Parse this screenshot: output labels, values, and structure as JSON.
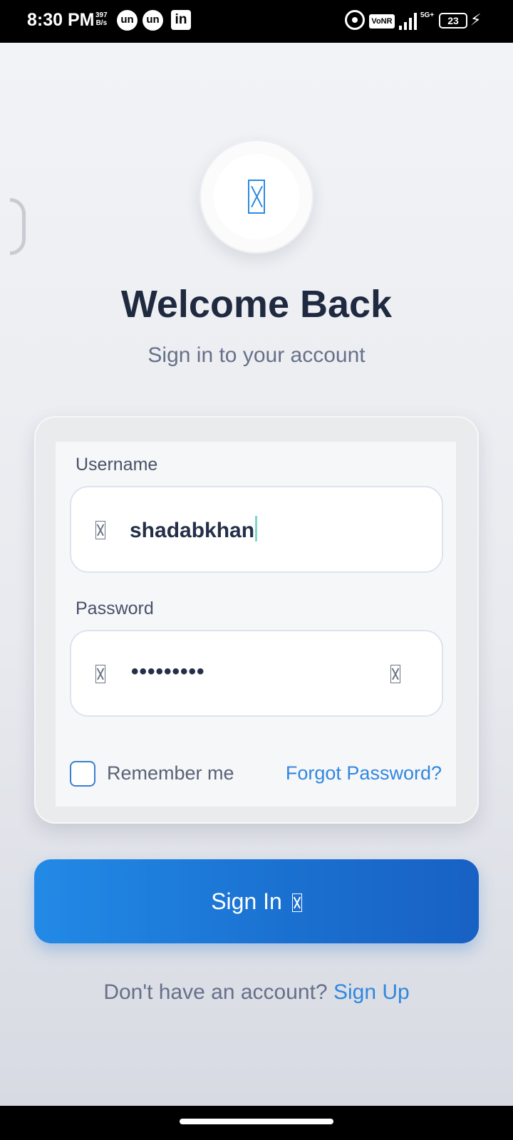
{
  "status_bar": {
    "time": "8:30 PM",
    "net_speed_value": "397",
    "net_speed_unit": "B/s",
    "app_icon_1": "un",
    "app_icon_2": "un",
    "app_icon_3": "in",
    "vonr": "VoNR",
    "network": "5G+",
    "battery": "23"
  },
  "header": {
    "title": "Welcome Back",
    "subtitle": "Sign in to your account"
  },
  "form": {
    "username_label": "Username",
    "username_value": "shadabkhan",
    "password_label": "Password",
    "password_masked": "•••••••••",
    "remember_label": "Remember me",
    "remember_checked": false,
    "forgot_label": "Forgot Password?"
  },
  "actions": {
    "signin_label": "Sign In",
    "signup_prompt": "Don't have an account?",
    "signup_link": "Sign Up"
  },
  "colors": {
    "accent": "#228ae6",
    "title": "#1f2a40",
    "link": "#3187df"
  },
  "icons": {
    "logo": "app-logo-icon",
    "username": "user-icon",
    "password": "lock-icon",
    "toggle": "eye-icon",
    "signin": "arrow-right-icon"
  }
}
